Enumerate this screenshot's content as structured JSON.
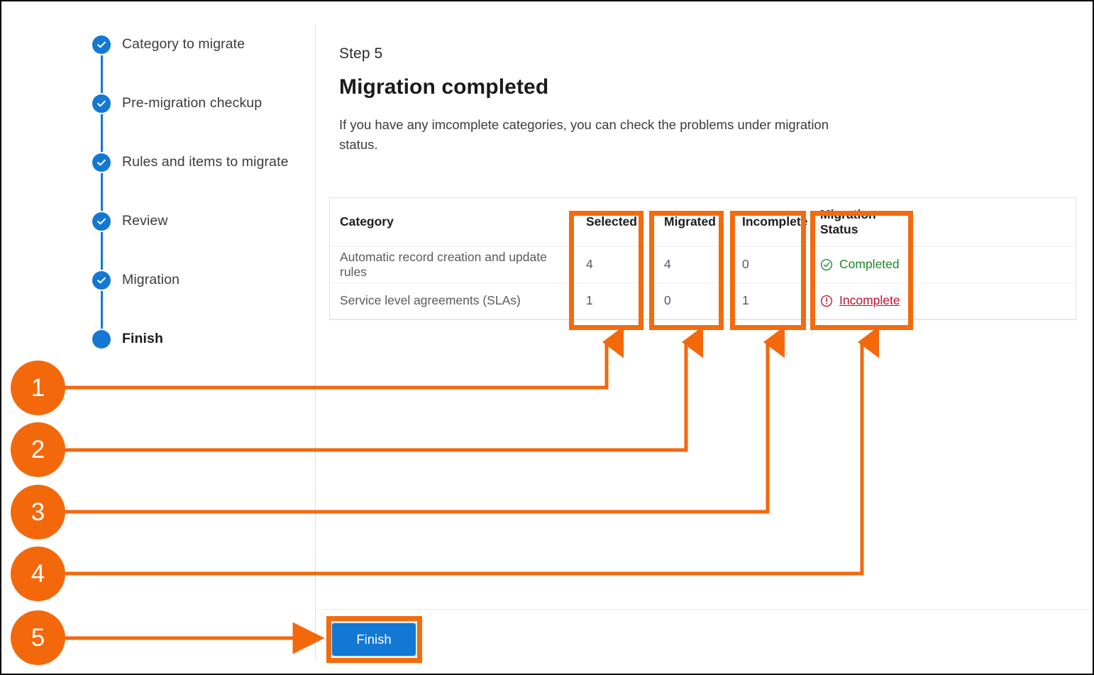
{
  "stepper": {
    "steps": [
      {
        "label": "Category to migrate",
        "state": "complete",
        "icon": "check-circle-icon"
      },
      {
        "label": "Pre-migration checkup",
        "state": "complete",
        "icon": "check-circle-icon"
      },
      {
        "label": "Rules and items to migrate",
        "state": "complete",
        "icon": "check-circle-icon"
      },
      {
        "label": "Review",
        "state": "complete",
        "icon": "check-circle-icon"
      },
      {
        "label": "Migration",
        "state": "complete",
        "icon": "check-circle-icon"
      },
      {
        "label": "Finish",
        "state": "current",
        "icon": "filled-circle-icon"
      }
    ]
  },
  "main": {
    "eyebrow": "Step 5",
    "title": "Migration completed",
    "description": "If you have any imcomplete categories, you can check the problems under migration status."
  },
  "table": {
    "headers": {
      "category": "Category",
      "selected": "Selected",
      "migrated": "Migrated",
      "incomplete": "Incomplete",
      "status": "Migration Status"
    },
    "rows": [
      {
        "category": "Automatic record creation and update rules",
        "selected": "4",
        "migrated": "4",
        "incomplete": "0",
        "status_text": "Completed",
        "status_kind": "ok",
        "status_icon": "check-circle-outline-icon"
      },
      {
        "category": "Service level agreements (SLAs)",
        "selected": "1",
        "migrated": "0",
        "incomplete": "1",
        "status_text": "Incomplete",
        "status_kind": "bad",
        "status_icon": "exclamation-circle-outline-icon"
      }
    ]
  },
  "footer": {
    "finish_label": "Finish"
  },
  "annotations": {
    "accent_color": "#f4680c",
    "callouts": [
      {
        "number": "1",
        "target": "selected-column"
      },
      {
        "number": "2",
        "target": "migrated-column"
      },
      {
        "number": "3",
        "target": "incomplete-column"
      },
      {
        "number": "4",
        "target": "migration-status-column"
      },
      {
        "number": "5",
        "target": "finish-button"
      }
    ]
  },
  "colors": {
    "step_blue": "#1378d4",
    "button_blue": "#1278d4",
    "status_green": "#1a8a26",
    "status_red": "#c5102b",
    "annotation_orange": "#f4680c"
  }
}
